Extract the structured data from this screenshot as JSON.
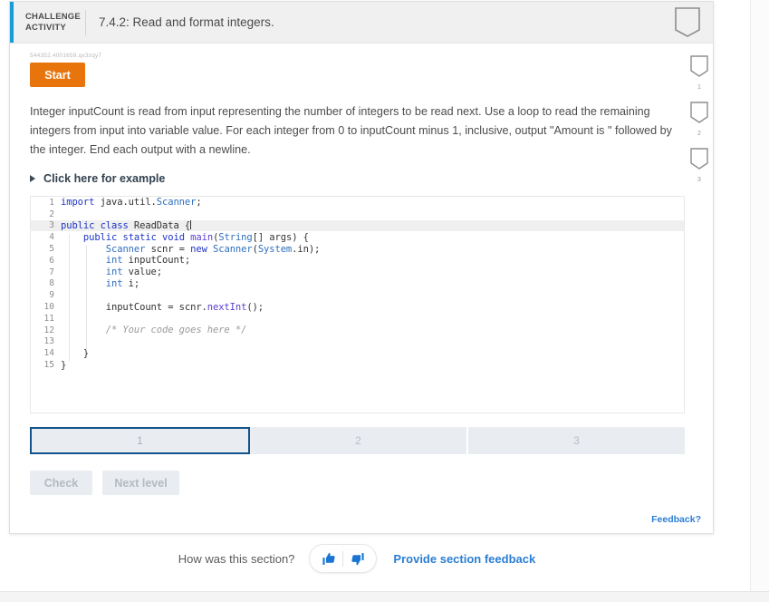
{
  "header": {
    "kicker": "CHALLENGE\nACTIVITY",
    "title": "7.4.2: Read and format integers.",
    "bookmark_icon": "bookmark-icon",
    "accent_color": "#1a9ad6"
  },
  "activity": {
    "id_text": "544352.4001659.qx3zqy7",
    "start_label": "Start",
    "start_color": "#e8740c",
    "instructions": "Integer inputCount is read from input representing the number of integers to be read next. Use a loop to read the remaining integers from input into variable value. For each integer from 0 to inputCount minus 1, inclusive, output \"Amount is \" followed by the integer. End each output with a newline.",
    "example_toggle_label": "Click here for example",
    "example_toggle_icon": "triangle-right-icon"
  },
  "code_editor": {
    "language": "Java",
    "active_line": 3,
    "lines": [
      {
        "num": "1",
        "text": "import java.util.Scanner;"
      },
      {
        "num": "2",
        "text": ""
      },
      {
        "num": "3",
        "text": "public class ReadData {"
      },
      {
        "num": "4",
        "text": "    public static void main(String[] args) {"
      },
      {
        "num": "5",
        "text": "        Scanner scnr = new Scanner(System.in);"
      },
      {
        "num": "6",
        "text": "        int inputCount;"
      },
      {
        "num": "7",
        "text": "        int value;"
      },
      {
        "num": "8",
        "text": "        int i;"
      },
      {
        "num": "9",
        "text": ""
      },
      {
        "num": "10",
        "text": "        inputCount = scnr.nextInt();"
      },
      {
        "num": "11",
        "text": ""
      },
      {
        "num": "12",
        "text": "        /* Your code goes here */"
      },
      {
        "num": "13",
        "text": ""
      },
      {
        "num": "14",
        "text": "    }"
      },
      {
        "num": "15",
        "text": "}"
      }
    ]
  },
  "levels": {
    "active_index": 0,
    "active_border_color": "#13538c",
    "tabs": [
      {
        "label": "1"
      },
      {
        "label": "2"
      },
      {
        "label": "3"
      }
    ]
  },
  "actions": {
    "check_label": "Check",
    "next_level_label": "Next level",
    "disabled": true
  },
  "card_feedback": {
    "label": "Feedback?",
    "link_color": "#2a7ed3"
  },
  "section_feedback": {
    "question": "How was this section?",
    "thumbs_up_icon": "thumbs-up-icon",
    "thumbs_down_icon": "thumbs-down-icon",
    "link_label": "Provide section feedback"
  },
  "right_rail": {
    "items": [
      {
        "icon": "bookmark-icon",
        "num": "1"
      },
      {
        "icon": "bookmark-icon",
        "num": "2"
      },
      {
        "icon": "bookmark-icon",
        "num": "3"
      }
    ]
  }
}
